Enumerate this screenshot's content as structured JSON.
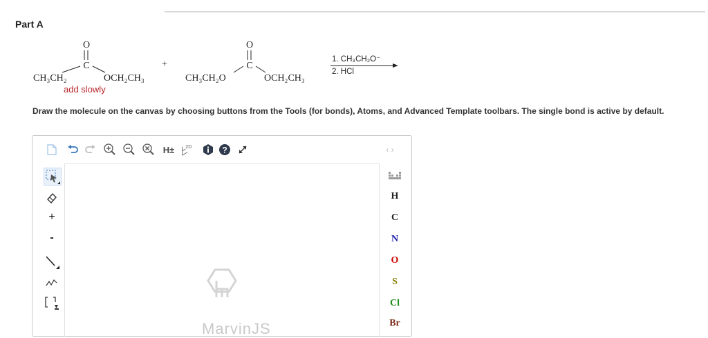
{
  "part": {
    "title": "Part A"
  },
  "reaction": {
    "reactant1": {
      "left": "CH₃CH₂",
      "right": "OCH₂CH₃",
      "carbon": "C",
      "oxygen": "O",
      "note": "add slowly"
    },
    "plus": "+",
    "reactant2": {
      "left": "CH₃CH₂O",
      "right": "OCH₂CH₃",
      "carbon": "C",
      "oxygen": "O"
    },
    "conditions": {
      "step1": "1. CH₃CH₂O⁻",
      "step2": "2. HCl"
    }
  },
  "instructions": "Draw the molecule on the canvas by choosing buttons from the Tools (for bonds), Atoms, and Advanced Template toolbars. The single bond is active by default.",
  "toolbar": {
    "hydrogens_label": "H±",
    "clean2d_label": "2D",
    "nav_arrows": "‹ ›"
  },
  "left_tools": {
    "plus": "+",
    "minus": "-"
  },
  "atoms": [
    "H",
    "C",
    "N",
    "O",
    "S",
    "Cl",
    "Br"
  ],
  "atom_colors": {
    "H": "#222222",
    "C": "#222222",
    "N": "#1f1fa8",
    "O": "#d10000",
    "S": "#8a7d00",
    "Cl": "#1a8a1a",
    "Br": "#7a2a1a"
  },
  "watermark": "MarvinJS"
}
